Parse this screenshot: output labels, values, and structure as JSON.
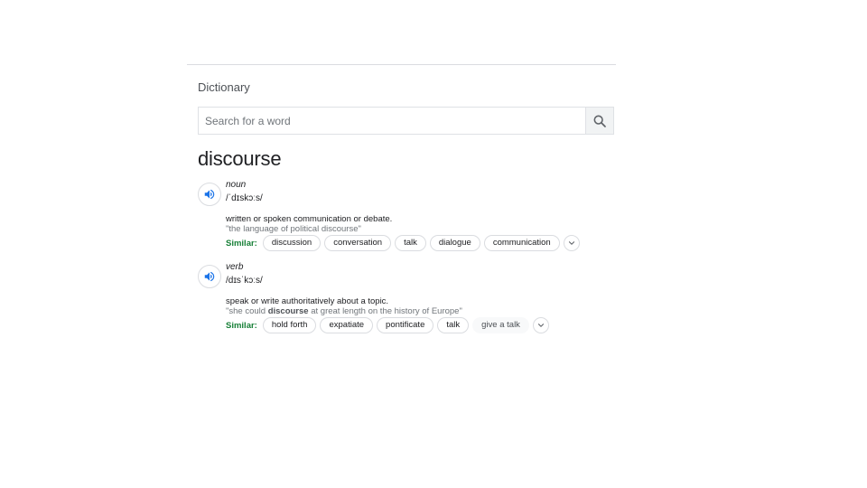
{
  "section": {
    "title": "Dictionary"
  },
  "search": {
    "placeholder": "Search for a word",
    "value": ""
  },
  "headword": "discourse",
  "entries": [
    {
      "pos": "noun",
      "phonetic": "/ˈdɪskɔːs/",
      "definition": "written or spoken communication or debate.",
      "example": "\"the language of political discourse\"",
      "similar_label": "Similar:",
      "similar": [
        "discussion",
        "conversation",
        "talk",
        "dialogue",
        "communication"
      ]
    },
    {
      "pos": "verb",
      "phonetic": "/dɪsˈkɔːs/",
      "definition": "speak or write authoritatively about a topic.",
      "example_before": "\"she could ",
      "example_bold": "discourse",
      "example_after": " at great length on the history of Europe\"",
      "similar_label": "Similar:",
      "similar": [
        "hold forth",
        "expatiate",
        "pontificate",
        "talk",
        "give a talk"
      ]
    }
  ],
  "icons": {
    "search": "search-icon",
    "speaker": "speaker-icon",
    "expand": "chevron-down-icon"
  },
  "colors": {
    "accent": "#1a73e8",
    "similar_label": "#188038"
  }
}
